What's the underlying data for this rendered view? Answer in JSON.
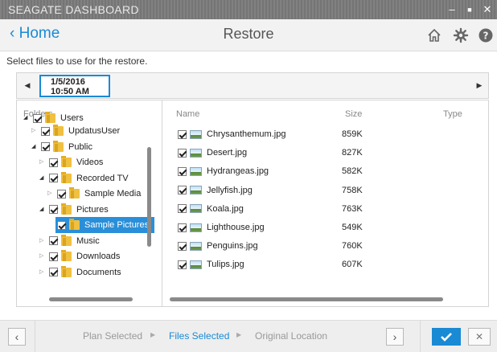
{
  "window": {
    "title": "SEAGATE DASHBOARD",
    "minimize_glyph": "–",
    "maximize_glyph": "■",
    "close_glyph": "✕"
  },
  "header": {
    "back_label": "‹ Home",
    "title": "Restore",
    "icons": [
      "home-icon",
      "gear-icon",
      "help-icon"
    ]
  },
  "instruction": "Select files to use for the restore.",
  "datebar": {
    "date": "1/5/2016",
    "time": "10:50 AM",
    "prev_glyph": "◀",
    "next_glyph": "▶"
  },
  "folders": {
    "label": "Folders",
    "items": [
      {
        "label": "Users",
        "depth": 0,
        "expander": "◢"
      },
      {
        "label": "UpdatusUser",
        "depth": 1,
        "expander": "▷"
      },
      {
        "label": "Public",
        "depth": 1,
        "expander": "◢"
      },
      {
        "label": "Videos",
        "depth": 2,
        "expander": "▷"
      },
      {
        "label": "Recorded TV",
        "depth": 2,
        "expander": "◢"
      },
      {
        "label": "Sample Media",
        "depth": 3,
        "expander": "▷"
      },
      {
        "label": "Pictures",
        "depth": 2,
        "expander": "◢"
      },
      {
        "label": "Sample Pictures",
        "depth": 3,
        "expander": "",
        "selected": true
      },
      {
        "label": "Music",
        "depth": 2,
        "expander": "▷"
      },
      {
        "label": "Downloads",
        "depth": 2,
        "expander": "▷"
      },
      {
        "label": "Documents",
        "depth": 2,
        "expander": "▷"
      }
    ]
  },
  "files": {
    "columns": {
      "name": "Name",
      "size": "Size",
      "type": "Type"
    },
    "rows": [
      {
        "name": "Chrysanthemum.jpg",
        "size": "859K"
      },
      {
        "name": "Desert.jpg",
        "size": "827K"
      },
      {
        "name": "Hydrangeas.jpg",
        "size": "582K"
      },
      {
        "name": "Jellyfish.jpg",
        "size": "758K"
      },
      {
        "name": "Koala.jpg",
        "size": "763K"
      },
      {
        "name": "Lighthouse.jpg",
        "size": "549K"
      },
      {
        "name": "Penguins.jpg",
        "size": "760K"
      },
      {
        "name": "Tulips.jpg",
        "size": "607K"
      }
    ]
  },
  "footer": {
    "prev_glyph": "‹",
    "next_glyph": "›",
    "steps": [
      {
        "label": "Plan Selected",
        "active": false
      },
      {
        "label": "Files Selected",
        "active": true
      },
      {
        "label": "Original Location",
        "active": false
      }
    ],
    "step_separator": "▶",
    "cancel_glyph": "✕"
  },
  "colors": {
    "accent": "#1a8ad4",
    "titlebar": "#7a7a7a",
    "selection": "#2a8fd8"
  }
}
